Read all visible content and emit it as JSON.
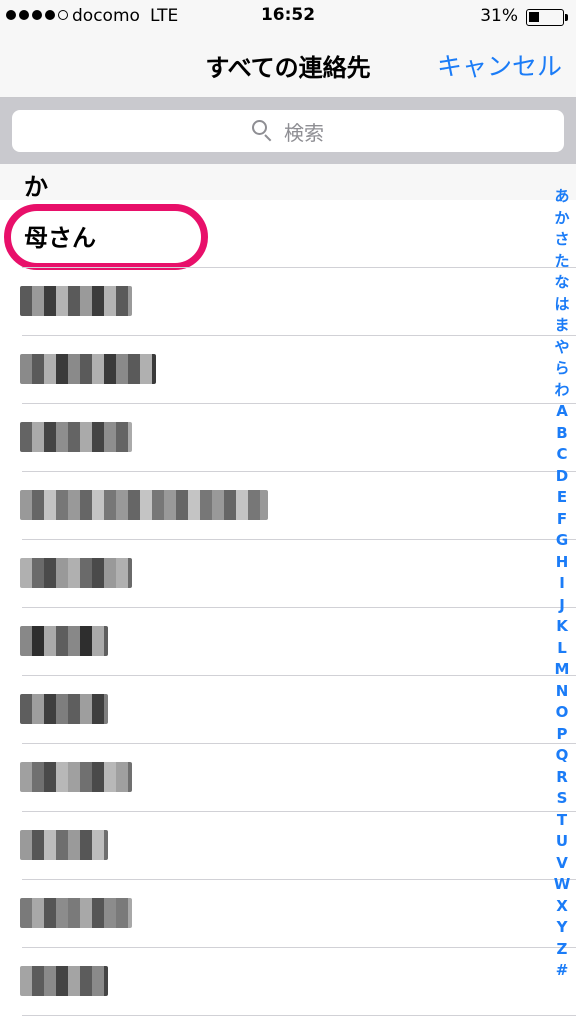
{
  "status_bar": {
    "carrier": "docomo",
    "network": "LTE",
    "time": "16:52",
    "battery_percent": "31%",
    "battery_level": 0.31,
    "signal_bars_filled": 4,
    "signal_bars_total": 5
  },
  "nav": {
    "title": "すべての連絡先",
    "cancel_label": "キャンセル"
  },
  "search": {
    "placeholder": "検索",
    "icon": "search-icon"
  },
  "section": {
    "header": "か"
  },
  "contacts": [
    {
      "name": "母さん",
      "highlighted": true
    },
    {
      "name": "",
      "blurred": true
    },
    {
      "name": "",
      "blurred": true
    },
    {
      "name": "",
      "blurred": true
    },
    {
      "name": "",
      "blurred": true
    },
    {
      "name": "",
      "blurred": true
    },
    {
      "name": "",
      "blurred": true
    },
    {
      "name": "",
      "blurred": true
    },
    {
      "name": "",
      "blurred": true
    },
    {
      "name": "",
      "blurred": true
    },
    {
      "name": "",
      "blurred": true
    },
    {
      "name": "",
      "blurred": true
    }
  ],
  "index": [
    "あ",
    "か",
    "さ",
    "た",
    "な",
    "は",
    "ま",
    "や",
    "ら",
    "わ",
    "A",
    "B",
    "C",
    "D",
    "E",
    "F",
    "G",
    "H",
    "I",
    "J",
    "K",
    "L",
    "M",
    "N",
    "O",
    "P",
    "Q",
    "R",
    "S",
    "T",
    "U",
    "V",
    "W",
    "X",
    "Y",
    "Z",
    "#"
  ],
  "colors": {
    "accent": "#1b7cf7",
    "highlight": "#e8106a"
  }
}
